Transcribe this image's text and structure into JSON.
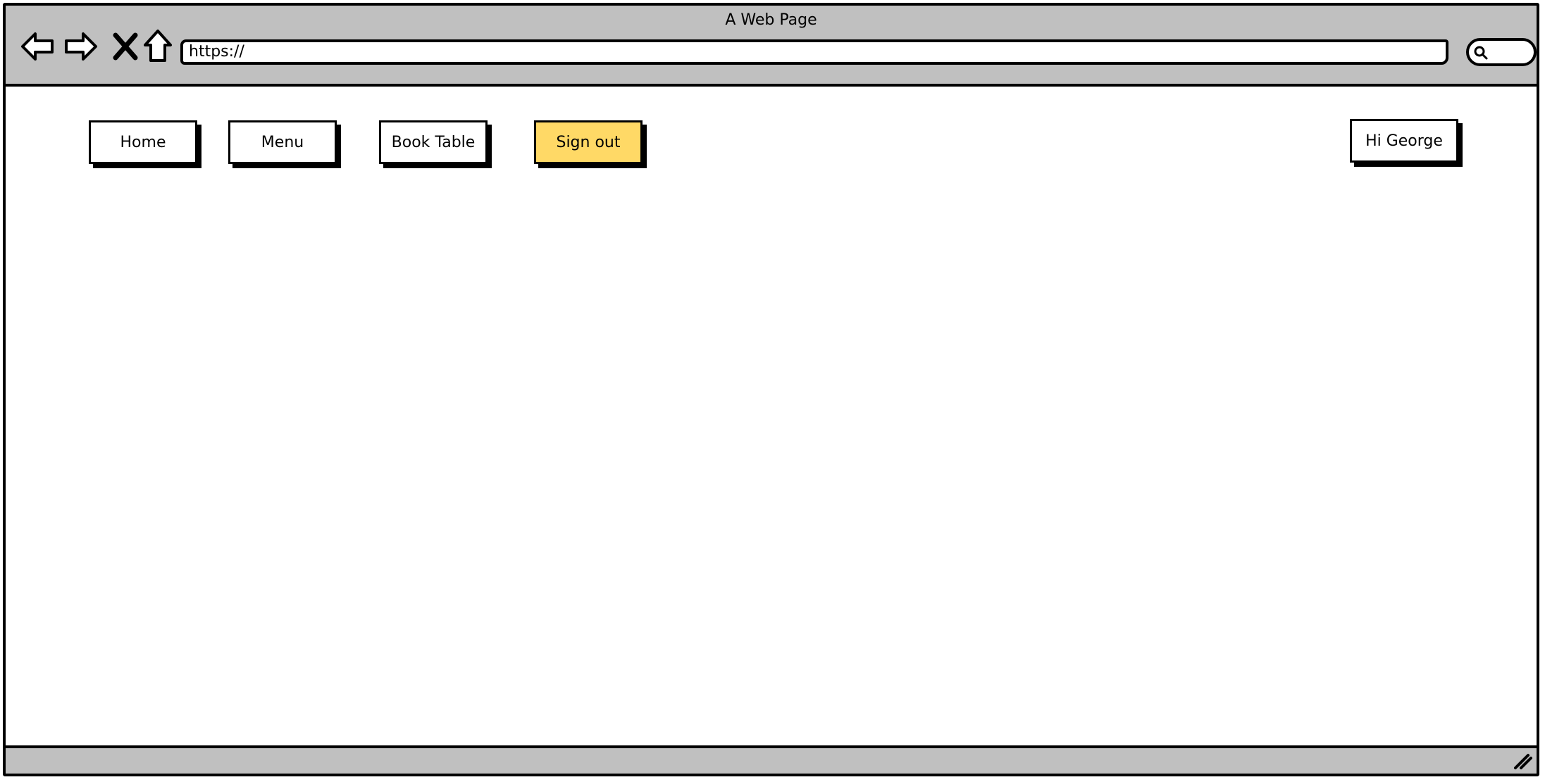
{
  "window": {
    "title": "A Web Page"
  },
  "toolbar": {
    "back_icon": "arrow-left-icon",
    "forward_icon": "arrow-right-icon",
    "stop_icon": "close-icon",
    "home_icon": "home-icon",
    "url_value": "https://",
    "search_icon": "search-icon"
  },
  "nav": {
    "buttons": [
      {
        "label": "Home"
      },
      {
        "label": "Menu"
      },
      {
        "label": "Book Table"
      },
      {
        "label": "Sign out",
        "highlight": true
      }
    ],
    "user_label": "Hi George"
  },
  "colors": {
    "chrome": "#c0c0c0",
    "highlight": "#ffd966",
    "ink": "#000000",
    "paper": "#ffffff"
  }
}
